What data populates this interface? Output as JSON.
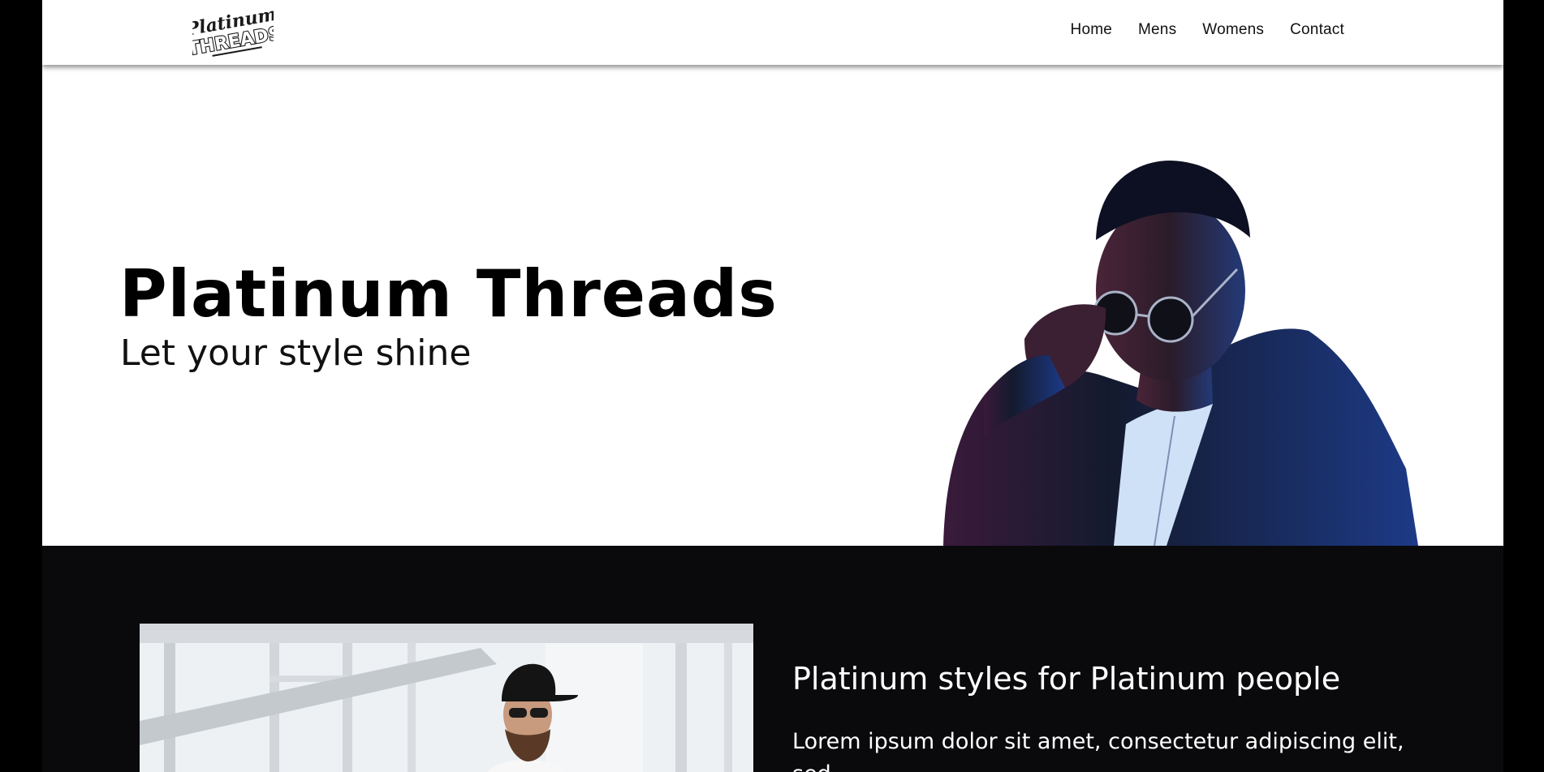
{
  "header": {
    "logo": {
      "line1": "Platinum",
      "line2": "THREADS",
      "icon": "brand-logo"
    },
    "nav": [
      {
        "label": "Home"
      },
      {
        "label": "Mens"
      },
      {
        "label": "Womens"
      },
      {
        "label": "Contact"
      }
    ]
  },
  "hero": {
    "title": "Platinum Threads",
    "subtitle": "Let your style shine",
    "image": "man-in-leather-jacket-and-sunglasses"
  },
  "feature": {
    "title": "Platinum styles for Platinum people",
    "text": "Lorem ipsum dolor sit amet, consectetur adipiscing elit, sed",
    "image": "man-with-cap-and-sunglasses"
  },
  "colors": {
    "page_bg": "#000000",
    "header_bg": "#ffffff",
    "hero_bg": "#ffffff",
    "feature_bg": "#0a0a0c",
    "text_dark": "#000000",
    "text_light": "#ffffff"
  }
}
